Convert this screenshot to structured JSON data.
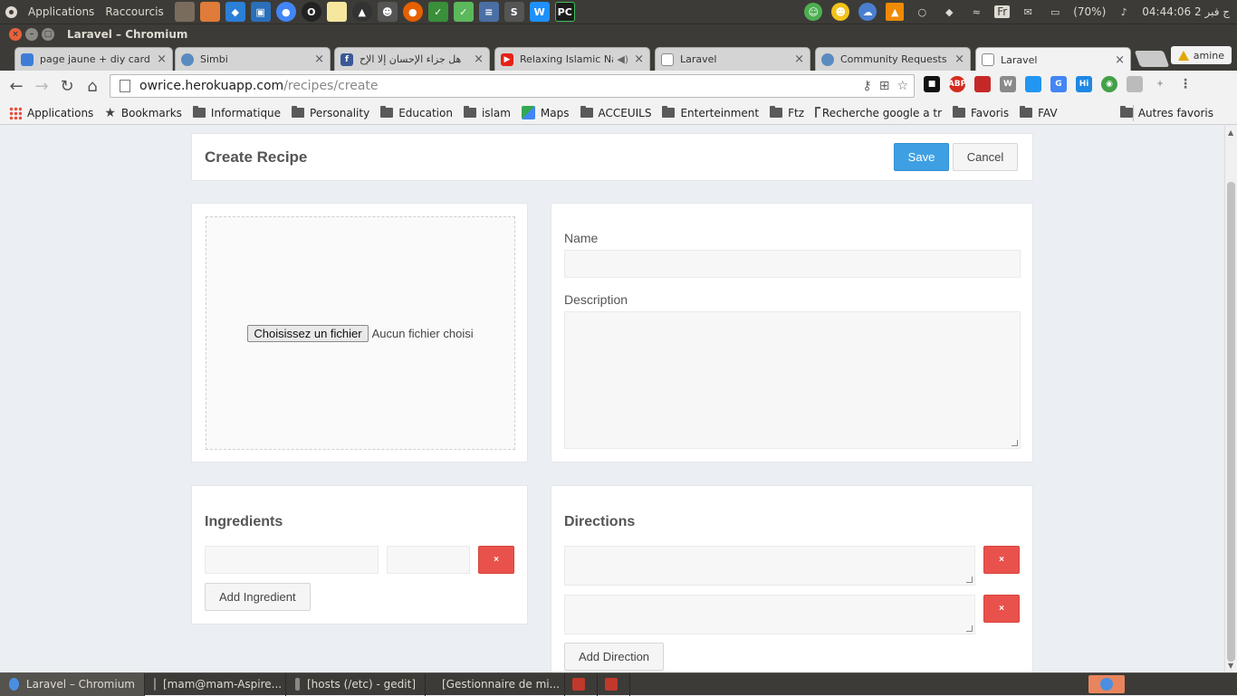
{
  "os_panel": {
    "menu": [
      "Applications",
      "Raccourcis"
    ],
    "battery": "(70%)",
    "clock": "04:44:06 2 ج فبر",
    "keyboard": "Fr"
  },
  "window": {
    "title": "Laravel – Chromium"
  },
  "tabs": [
    {
      "label": "page jaune + diy card v",
      "color": "#3d7dd8"
    },
    {
      "label": "Simbi",
      "color": "#5a8bc0"
    },
    {
      "label": "هل جزاء الإحسان إلا الإح",
      "color": "#3b5998"
    },
    {
      "label": "Relaxing Islamic Na",
      "color": "#e62117"
    },
    {
      "label": "Laravel",
      "color": "#999999"
    },
    {
      "label": "Community Requests - S",
      "color": "#5a8bc0"
    },
    {
      "label": "Laravel",
      "color": "#999999"
    }
  ],
  "profile": {
    "name": "amine"
  },
  "address_bar": {
    "host": "owrice.herokuapp.com",
    "path": "/recipes/create"
  },
  "bookmarks": {
    "items": [
      {
        "label": "Applications",
        "icon": "apps-grid-icon"
      },
      {
        "label": "Bookmarks",
        "icon": "star-icon"
      },
      {
        "label": "Informatique",
        "icon": "folder-icon"
      },
      {
        "label": "Personality",
        "icon": "folder-icon"
      },
      {
        "label": "Education",
        "icon": "folder-icon"
      },
      {
        "label": "islam",
        "icon": "folder-icon"
      },
      {
        "label": "Maps",
        "icon": "maps-icon"
      },
      {
        "label": "ACCEUILS",
        "icon": "folder-icon"
      },
      {
        "label": "Enterteinment",
        "icon": "folder-icon"
      },
      {
        "label": "Ftz",
        "icon": "folder-icon"
      },
      {
        "label": "Recherche google a tr",
        "icon": "folder-icon"
      },
      {
        "label": "Favoris",
        "icon": "folder-icon"
      },
      {
        "label": "FAV",
        "icon": "folder-icon"
      }
    ],
    "other": "Autres favoris"
  },
  "page": {
    "title": "Create Recipe",
    "save_label": "Save",
    "cancel_label": "Cancel",
    "file_button": "Choisissez un fichier",
    "file_status": "Aucun fichier choisi",
    "name_label": "Name",
    "name_value": "",
    "description_label": "Description",
    "description_value": "",
    "ingredients_title": "Ingredients",
    "ingredient_rows": [
      {
        "name": "",
        "qty": ""
      }
    ],
    "add_ingredient": "Add Ingredient",
    "directions_title": "Directions",
    "direction_rows": [
      {
        "text": ""
      },
      {
        "text": ""
      }
    ],
    "add_direction": "Add Direction",
    "delete_glyph": "×"
  },
  "taskbar": [
    {
      "label": "Laravel – Chromium",
      "active": true,
      "color": "#4a8fe3"
    },
    {
      "label": "[mam@mam-Aspire...",
      "active": false,
      "color": "#444444"
    },
    {
      "label": "[hosts (/etc) - gedit]",
      "active": false,
      "color": "#888888"
    },
    {
      "label": "[Gestionnaire de mi...",
      "active": false,
      "color": "#666666"
    }
  ]
}
